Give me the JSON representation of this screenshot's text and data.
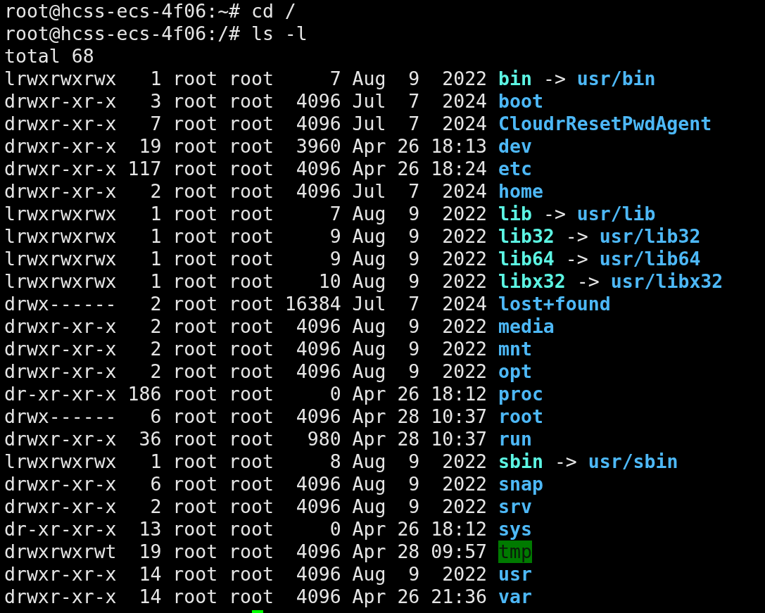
{
  "commands": [
    "root@hcss-ecs-4f06:~# cd /",
    "root@hcss-ecs-4f06:/# ls -l"
  ],
  "total": "total 68",
  "entries": [
    {
      "details": "lrwxrwxrwx   1 root root     7 Aug  9  2022",
      "name": "bin",
      "kind": "link",
      "arrow": "->",
      "target": "usr/bin"
    },
    {
      "details": "drwxr-xr-x   3 root root  4096 Jul  7  2024",
      "name": "boot",
      "kind": "dir"
    },
    {
      "details": "drwxr-xr-x   7 root root  4096 Jul  7  2024",
      "name": "CloudrResetPwdAgent",
      "kind": "dir"
    },
    {
      "details": "drwxr-xr-x  19 root root  3960 Apr 26 18:13",
      "name": "dev",
      "kind": "dir"
    },
    {
      "details": "drwxr-xr-x 117 root root  4096 Apr 26 18:24",
      "name": "etc",
      "kind": "dir"
    },
    {
      "details": "drwxr-xr-x   2 root root  4096 Jul  7  2024",
      "name": "home",
      "kind": "dir"
    },
    {
      "details": "lrwxrwxrwx   1 root root     7 Aug  9  2022",
      "name": "lib",
      "kind": "link",
      "arrow": "->",
      "target": "usr/lib"
    },
    {
      "details": "lrwxrwxrwx   1 root root     9 Aug  9  2022",
      "name": "lib32",
      "kind": "link",
      "arrow": "->",
      "target": "usr/lib32"
    },
    {
      "details": "lrwxrwxrwx   1 root root     9 Aug  9  2022",
      "name": "lib64",
      "kind": "link",
      "arrow": "->",
      "target": "usr/lib64"
    },
    {
      "details": "lrwxrwxrwx   1 root root    10 Aug  9  2022",
      "name": "libx32",
      "kind": "link",
      "arrow": "->",
      "target": "usr/libx32"
    },
    {
      "details": "drwx------   2 root root 16384 Jul  7  2024",
      "name": "lost+found",
      "kind": "dir"
    },
    {
      "details": "drwxr-xr-x   2 root root  4096 Aug  9  2022",
      "name": "media",
      "kind": "dir"
    },
    {
      "details": "drwxr-xr-x   2 root root  4096 Aug  9  2022",
      "name": "mnt",
      "kind": "dir"
    },
    {
      "details": "drwxr-xr-x   2 root root  4096 Aug  9  2022",
      "name": "opt",
      "kind": "dir"
    },
    {
      "details": "dr-xr-xr-x 186 root root     0 Apr 26 18:12",
      "name": "proc",
      "kind": "dir"
    },
    {
      "details": "drwx------   6 root root  4096 Apr 28 10:37",
      "name": "root",
      "kind": "dir"
    },
    {
      "details": "drwxr-xr-x  36 root root   980 Apr 28 10:37",
      "name": "run",
      "kind": "dir"
    },
    {
      "details": "lrwxrwxrwx   1 root root     8 Aug  9  2022",
      "name": "sbin",
      "kind": "link",
      "arrow": "->",
      "target": "usr/sbin"
    },
    {
      "details": "drwxr-xr-x   6 root root  4096 Aug  9  2022",
      "name": "snap",
      "kind": "dir"
    },
    {
      "details": "drwxr-xr-x   2 root root  4096 Aug  9  2022",
      "name": "srv",
      "kind": "dir"
    },
    {
      "details": "dr-xr-xr-x  13 root root     0 Apr 26 18:12",
      "name": "sys",
      "kind": "dir"
    },
    {
      "details": "drwxrwxrwt  19 root root  4096 Apr 28 09:57",
      "name": "tmp",
      "kind": "sticky"
    },
    {
      "details": "drwxr-xr-x  14 root root  4096 Aug  9  2022",
      "name": "usr",
      "kind": "dir"
    },
    {
      "details": "drwxr-xr-x  14 root root  4096 Apr 26 21:36",
      "name": "var",
      "kind": "dir"
    }
  ]
}
